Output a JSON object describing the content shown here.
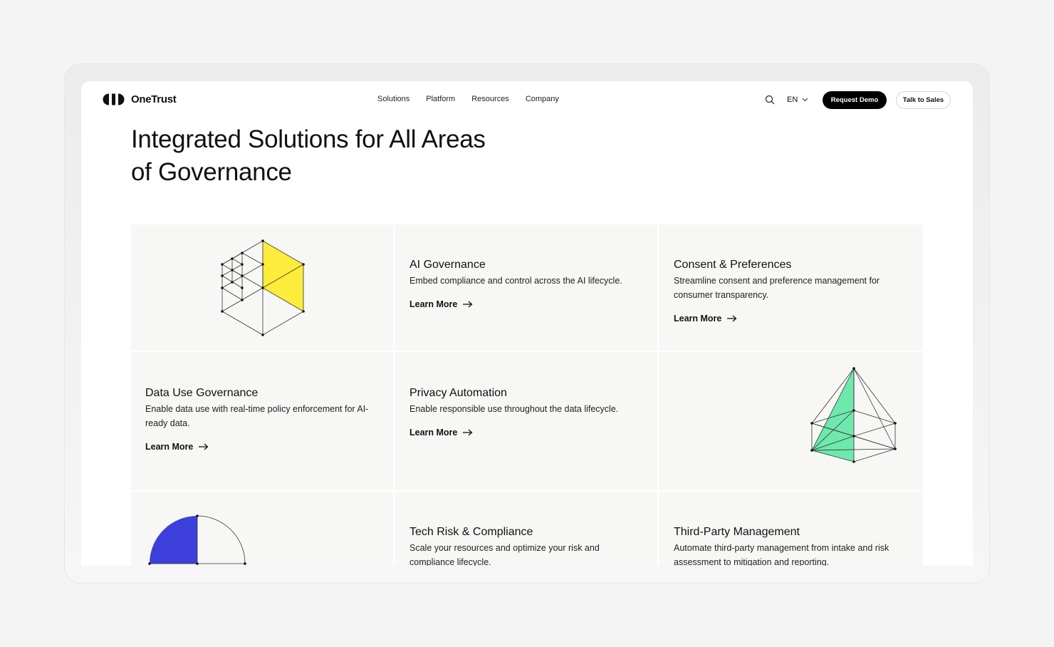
{
  "header": {
    "brand": "OneTrust",
    "nav": [
      "Solutions",
      "Platform",
      "Resources",
      "Company"
    ],
    "language": "EN",
    "request_demo": "Request Demo",
    "talk_to_sales": "Talk to Sales"
  },
  "hero": {
    "title_line1": "Integrated Solutions for All Areas",
    "title_line2": "of Governance"
  },
  "cards": [
    {
      "title": "AI Governance",
      "desc": "Embed compliance and control across the AI lifecycle.",
      "link": "Learn More"
    },
    {
      "title": "Consent & Preferences",
      "desc": "Streamline consent and preference management for consumer transparency.",
      "link": "Learn More"
    },
    {
      "title": "Data Use Governance",
      "desc": "Enable data use with real-time policy enforcement for AI-ready data.",
      "link": "Learn More"
    },
    {
      "title": "Privacy Automation",
      "desc": "Enable responsible use throughout the data lifecycle.",
      "link": "Learn More"
    },
    {
      "title": "Tech Risk & Compliance",
      "desc": "Scale your resources and optimize your risk and compliance lifecycle."
    },
    {
      "title": "Third-Party Management",
      "desc": "Automate third-party management from intake and risk assessment to mitigation and reporting."
    }
  ],
  "colors": {
    "yellow": "#fdec3b",
    "green": "#6ee8ac",
    "blue": "#3c3fd9",
    "button_dark": "#000000"
  }
}
